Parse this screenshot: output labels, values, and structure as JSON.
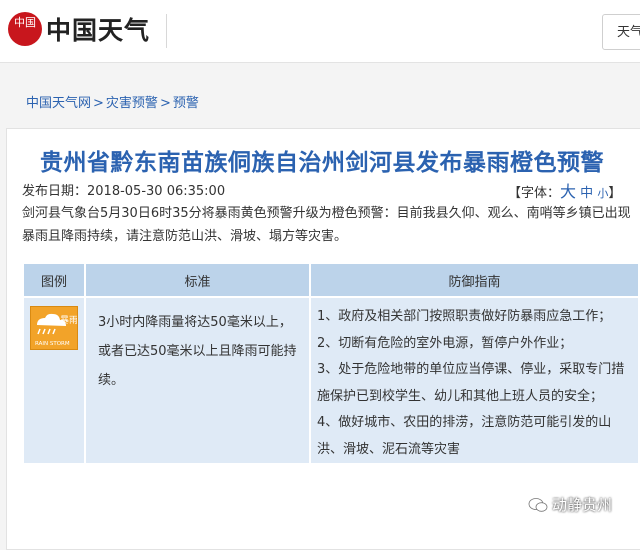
{
  "header": {
    "logo_seal": "中国",
    "logo_text": "中国天气",
    "search_text": "天气"
  },
  "breadcrumb": {
    "items": [
      "中国天气网",
      "灾害预警",
      "预警"
    ],
    "separator": ">"
  },
  "article": {
    "title": "贵州省黔东南苗族侗族自治州剑河县发布暴雨橙色预警",
    "date_label": "发布日期：",
    "date_value": "2018-05-30 06:35:00",
    "font_label": "【字体：",
    "font_big": "大",
    "font_mid": "中",
    "font_small": "小",
    "font_close": "】",
    "summary": "剑河县气象台5月30日6时35分将暴雨黄色预警升级为橙色预警：目前我县久仰、观么、南哨等乡镇已出现暴雨且降雨持续，请注意防范山洪、滑坡、塌方等灾害。"
  },
  "table": {
    "headers": [
      "图例",
      "标准",
      "防御指南"
    ],
    "icon_name": "rainstorm-orange-warning-icon",
    "icon_caption": "RAIN STORM",
    "icon_label": "暴雨",
    "standard": "3小时内降雨量将达50毫米以上，或者已达50毫米以上且降雨可能持续。",
    "guides": [
      "1、政府及相关部门按照职责做好防暴雨应急工作；",
      "2、切断有危险的室外电源，暂停户外作业；",
      "3、处于危险地带的单位应当停课、停业，采取专门措施保护已到校学生、幼儿和其他上班人员的安全；",
      "4、做好城市、农田的排涝，注意防范可能引发的山洪、滑坡、泥石流等灾害"
    ]
  },
  "watermark": {
    "text": "动静贵州"
  },
  "colors": {
    "link_blue": "#2b62b0",
    "header_row": "#bcd3ea",
    "body_row": "#dfeaf6",
    "warning_orange": "#f2a329",
    "logo_red": "#c8161d"
  }
}
